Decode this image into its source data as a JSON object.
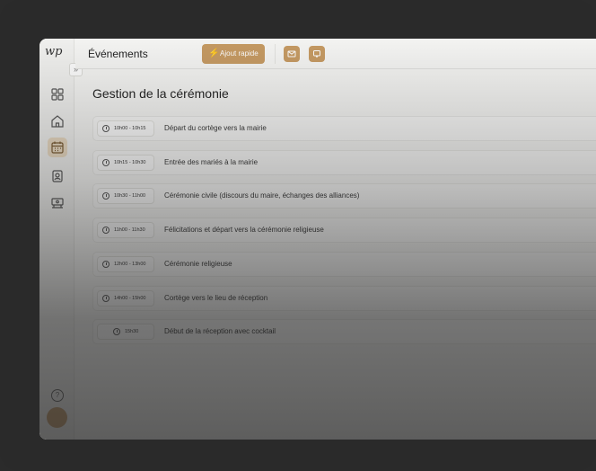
{
  "header": {
    "title": "Événements",
    "quick_add_label": "Ajout rapide"
  },
  "main": {
    "title": "Gestion de la cérémonie",
    "events": [
      {
        "time": "10h00 - 10h15",
        "label": "Départ du cortège vers la mairie"
      },
      {
        "time": "10h15 - 10h30",
        "label": "Entrée des mariés à la mairie"
      },
      {
        "time": "10h30 - 11h00",
        "label": "Cérémonie civile (discours du maire, échanges des alliances)"
      },
      {
        "time": "11h00 - 11h30",
        "label": "Félicitations et départ vers la cérémonie religieuse"
      },
      {
        "time": "12h00 - 13h00",
        "label": "Cérémonie religieuse"
      },
      {
        "time": "14h00 - 15h00",
        "label": "Cortège vers le lieu de réception"
      },
      {
        "time": "15h30",
        "label": "Début de la réception avec cocktail"
      }
    ]
  },
  "sidebar": {
    "icons": [
      "dashboard-icon",
      "home-icon",
      "calendar-icon",
      "contacts-icon",
      "gift-icon"
    ]
  },
  "colors": {
    "accent": "#c79b63",
    "accent_light": "#ecdcc3"
  }
}
